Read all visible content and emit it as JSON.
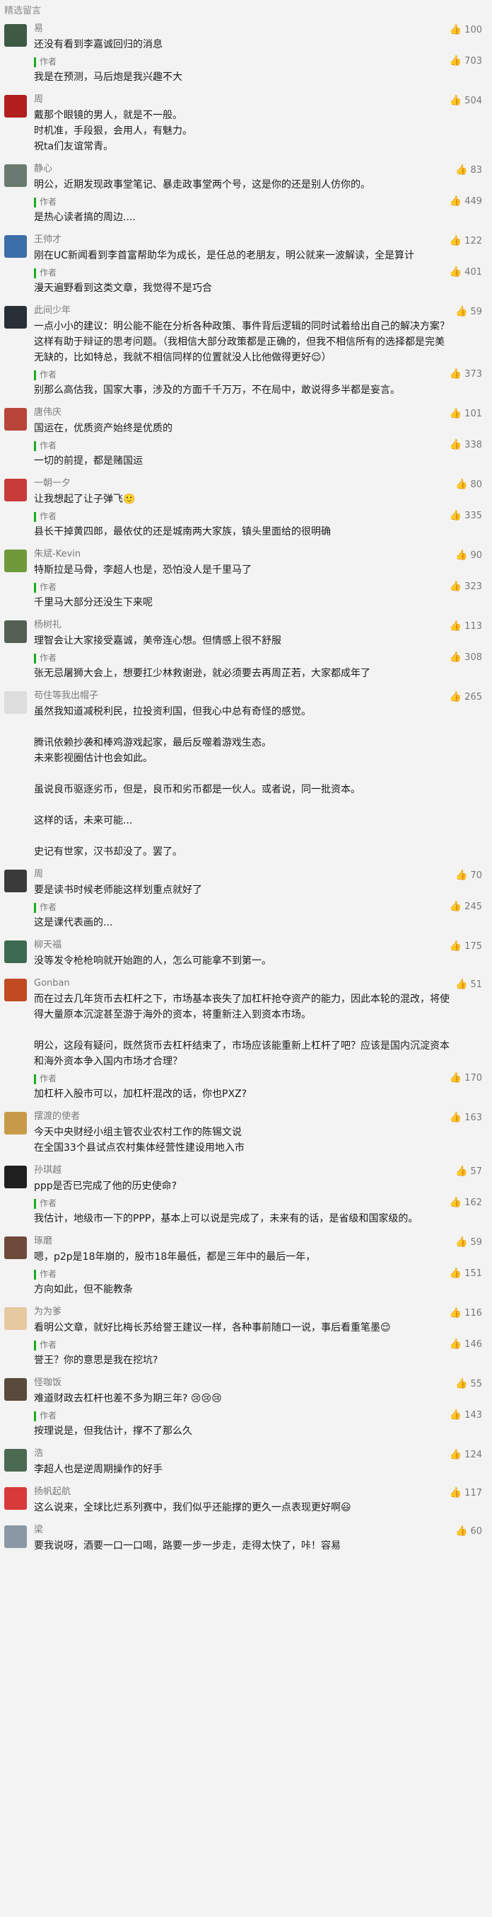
{
  "header": {
    "title": "精选留言"
  },
  "author_label": "作者",
  "comments": [
    {
      "name": "易",
      "avatar_color": "#3e5a44",
      "likes": "100",
      "text": "还没有看到李嘉诚回归的消息",
      "reply": {
        "text": "我是在预测，马后炮是我兴趣不大",
        "likes": "703"
      }
    },
    {
      "name": "周 ",
      "avatar_color": "#b31e1e",
      "likes": "504",
      "text": "戴那个眼镜的男人，就是不一般。\n时机准，手段狠，会用人，有魅力。\n祝ta们友谊常青。",
      "reply": null
    },
    {
      "name": "静心",
      "avatar_color": "#6a7a70",
      "likes": "83",
      "text": "明公，近期发现政事堂笔记、暴走政事堂两个号，这是你的还是别人仿你的。",
      "reply": {
        "text": "是热心读者搞的周边....",
        "likes": "449"
      }
    },
    {
      "name": "王帅才",
      "avatar_color": "#3c6fa8",
      "likes": "122",
      "text": "刚在UC新闻看到李首富帮助华为成长，是任总的老朋友，明公就来一波解读，全是算计",
      "reply": {
        "text": "漫天遍野看到这类文章，我觉得不是巧合",
        "likes": "401"
      }
    },
    {
      "name": "此间少年",
      "avatar_color": "#2a2f36",
      "likes": "59",
      "text": "一点小小的建议：明公能不能在分析各种政策、事件背后逻辑的同时试着给出自己的解决方案？这样有助于辩证的思考问题。（我相信大部分政策都是正确的，但我不相信所有的选择都是完美无缺的，比如特总，我就不相信同样的位置就没人比他做得更好😌）",
      "reply": {
        "text": "别那么高估我，国家大事，涉及的方面千千万万，不在局中，敢说得多半都是妄言。",
        "likes": "373"
      }
    },
    {
      "name": "唐伟庆",
      "avatar_color": "#b8443a",
      "likes": "101",
      "text": "国运在，优质资产始终是优质的",
      "reply": {
        "text": "一切的前提，都是赌国运",
        "likes": "338"
      }
    },
    {
      "name": "一朝一夕",
      "avatar_color": "#c93a3a",
      "likes": "80",
      "text": "让我想起了让子弹飞🙂",
      "reply": {
        "text": "县长干掉黄四郎，最依仗的还是城南两大家族，镇头里面给的很明确",
        "likes": "335"
      }
    },
    {
      "name": "朱斌-Kevin",
      "avatar_color": "#6f9a3a",
      "likes": "90",
      "text": "特斯拉是马骨，李超人也是，恐怕没人是千里马了",
      "reply": {
        "text": "千里马大部分还没生下来呢",
        "likes": "323"
      }
    },
    {
      "name": "杨树礼",
      "avatar_color": "#556055",
      "likes": "113",
      "text": "理智会让大家接受嘉诚，美帝连心想。但情感上很不舒服",
      "reply": {
        "text": "张无忌屠狮大会上，想要扛少林救谢逊，就必须要去再周芷若，大家都成年了",
        "likes": "308"
      }
    },
    {
      "name": "苟住等我出帽子",
      "avatar_color": "#dddddd",
      "likes": "265",
      "text": "虽然我知道减税利民，拉投资利国，但我心中总有奇怪的感觉。\n\n腾讯依赖抄袭和棒鸡游戏起家，最后反噬着游戏生态。\n未来影视圈估计也会如此。\n\n虽说良币驱逐劣币，但是，良币和劣币都是一伙人。或者说，同一批资本。\n\n这样的话，未来可能...\n\n史记有世家，汉书却没了。罢了。",
      "reply": null
    },
    {
      "name": "周",
      "avatar_color": "#3a3a3a",
      "likes": "70",
      "text": "要是读书时候老师能这样划重点就好了",
      "reply": {
        "text": "这是课代表画的...",
        "likes": "245"
      }
    },
    {
      "name": "柳天福",
      "avatar_color": "#3d6b52",
      "likes": "175",
      "text": "没等发令枪枪响就开始跑的人，怎么可能拿不到第一。",
      "reply": null
    },
    {
      "name": "Gonban",
      "avatar_color": "#c24a22",
      "likes": "51",
      "text": "而在过去几年货币去杠杆之下，市场基本丧失了加杠杆抢夺资产的能力，因此本轮的混改，将使得大量原本沉淀甚至游于海外的资本，将重新注入到资本市场。\n\n明公，这段有疑问，既然货币去杠杆结束了，市场应该能重新上杠杆了吧？应该是国内沉淀资本和海外资本争入国内市场才合理？",
      "reply": {
        "text": "加杠杆入股市可以，加杠杆混改的话，你也PXZ?",
        "likes": "170"
      }
    },
    {
      "name": "摆渡的使者",
      "avatar_color": "#c79a4a",
      "likes": "163",
      "text": "今天中央财经小组主管农业农村工作的陈锡文说\n在全国33个县试点农村集体经营性建设用地入市",
      "reply": null
    },
    {
      "name": "孙琪越",
      "avatar_color": "#1f1f1f",
      "likes": "57",
      "text": "ppp是否已完成了他的历史使命?",
      "reply": {
        "text": "我估计，地级市一下的PPP，基本上可以说是完成了，未来有的话，是省级和国家级的。",
        "likes": "162"
      }
    },
    {
      "name": "琢磨",
      "avatar_color": "#6e4a3a",
      "likes": "59",
      "text": "嗯，p2p是18年崩的，股市18年最低，都是三年中的最后一年，",
      "reply": {
        "text": "方向如此，但不能教条",
        "likes": "151"
      }
    },
    {
      "name": "为为爹",
      "avatar_color": "#e7c9a0",
      "likes": "116",
      "text": "看明公文章，就好比梅长苏给誉王建议一样，各种事前随口一说，事后看重笔墨😌",
      "reply": {
        "text": "誉王？你的意思是我在挖坑?",
        "likes": "146"
      }
    },
    {
      "name": "怪咖饭",
      "avatar_color": "#5a4a3a",
      "likes": "55",
      "text": "难道财政去杠杆也差不多为期三年? 😢😢😢",
      "reply": {
        "text": "按理说是，但我估计，撑不了那么久",
        "likes": "143"
      }
    },
    {
      "name": "浩",
      "avatar_color": "#4a6a52",
      "likes": "124",
      "text": "李超人也是逆周期操作的好手",
      "reply": null
    },
    {
      "name": "扬帆起航",
      "avatar_color": "#d83a3a",
      "likes": "117",
      "text": "这么说来，全球比烂系列赛中，我们似乎还能撑的更久一点表现更好啊😃",
      "reply": null
    },
    {
      "name": "梁",
      "avatar_color": "#8a98a6",
      "likes": "60",
      "text": "要我说呀，酒要一口一口喝，路要一步一步走，走得太快了，咔！容易",
      "reply": null
    }
  ]
}
